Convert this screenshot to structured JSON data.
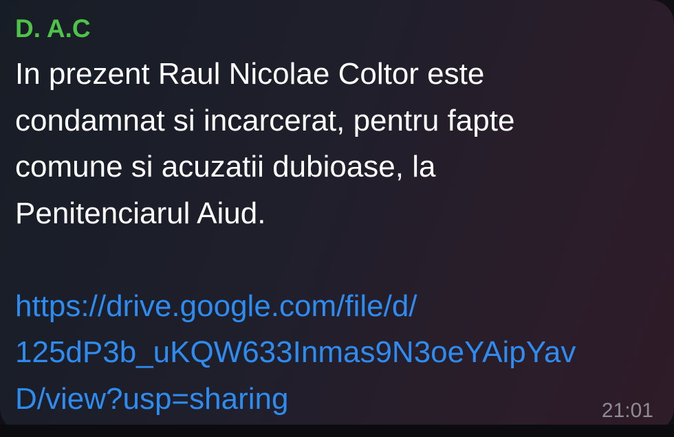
{
  "message": {
    "sender": "D. A.C",
    "sender_color": "#4fc24a",
    "text_lines": [
      "In prezent Raul Nicolae Coltor este",
      "condamnat si incarcerat, pentru fapte",
      "comune si acuzatii dubioase, la",
      "Penitenciarul Aiud."
    ],
    "link_lines": [
      "https://drive.google.com/file/d/",
      "125dP3b_uKQW633Inmas9N3oeYAipYav",
      "D/view?usp=sharing"
    ],
    "link_color": "#2e8cf0",
    "time": "21:01"
  }
}
